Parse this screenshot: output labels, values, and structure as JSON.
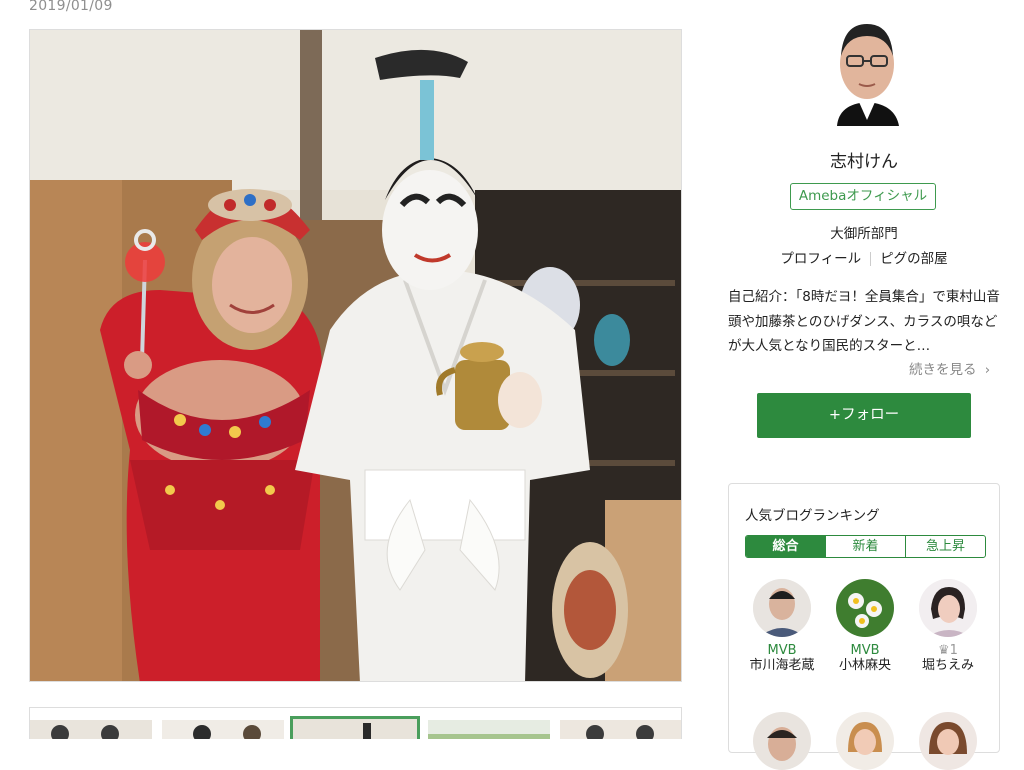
{
  "post": {
    "date": "2019/01/09"
  },
  "profile": {
    "name": "志村けん",
    "official_badge": "Amebaオフィシャル",
    "department": "大御所部門",
    "profile_link": "プロフィール",
    "blog_link": "ピグの部屋",
    "intro": "自己紹介：「8時だヨ！全員集合」で東村山音頭や加藤茶とのひげダンス、カラスの唄などが大人気となり国民的スターと…",
    "more_label": "続きを見る",
    "follow_label": "+フォロー"
  },
  "ranking": {
    "title": "人気ブログランキング",
    "tabs": [
      "総合",
      "新着",
      "急上昇"
    ],
    "items": [
      {
        "badge": "MVB",
        "name": "市川海老蔵"
      },
      {
        "badge": "MVB",
        "name": "小林麻央"
      },
      {
        "badge": "♛1",
        "name": "堀ちえみ"
      }
    ]
  },
  "colors": {
    "accent": "#2d8a3e",
    "date_text": "#8f8f8f"
  }
}
